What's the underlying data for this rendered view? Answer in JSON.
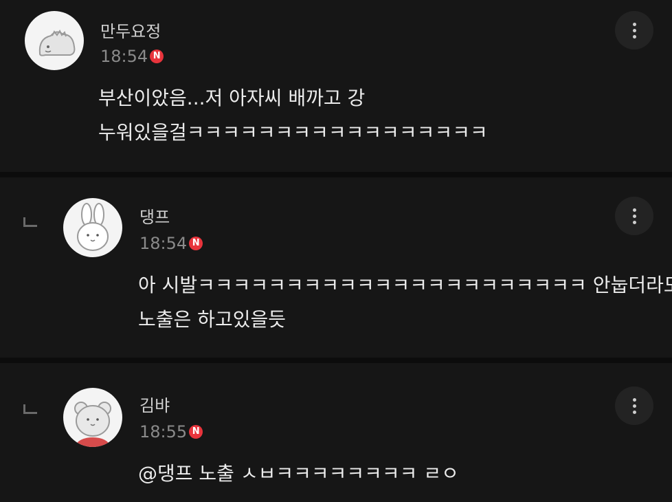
{
  "comments": [
    {
      "nickname": "만두요정",
      "time": "18:54",
      "badge": "N",
      "lines": [
        "부산이았음...저 아자씨 배까고 강",
        "누워있을걸ㅋㅋㅋㅋㅋㅋㅋㅋㅋㅋㅋㅋㅋㅋㅋㅋㅋ"
      ],
      "avatar_icon": "dinosaur-avatar-icon",
      "is_reply": false
    },
    {
      "nickname": "댕프",
      "time": "18:54",
      "badge": "N",
      "lines": [
        "아 시발ㅋㅋㅋㅋㅋㅋㅋㅋㅋㅋㅋㅋㅋㅋㅋㅋㅋㅋㅋㅋㅋㅋ 안눕더라도",
        "노출은 하고있을듯"
      ],
      "avatar_icon": "rabbit-avatar-icon",
      "is_reply": true
    },
    {
      "nickname": "김뱌",
      "time": "18:55",
      "badge": "N",
      "lines": [
        "@댕프 노출 ㅅㅂㅋㅋㅋㅋㅋㅋㅋㅋ ㄹㅇ"
      ],
      "avatar_icon": "bear-avatar-icon",
      "is_reply": true
    }
  ],
  "colors": {
    "background": "#131313",
    "badge": "#e8343c",
    "text": "#ececec",
    "meta": "#8a8a8a"
  }
}
